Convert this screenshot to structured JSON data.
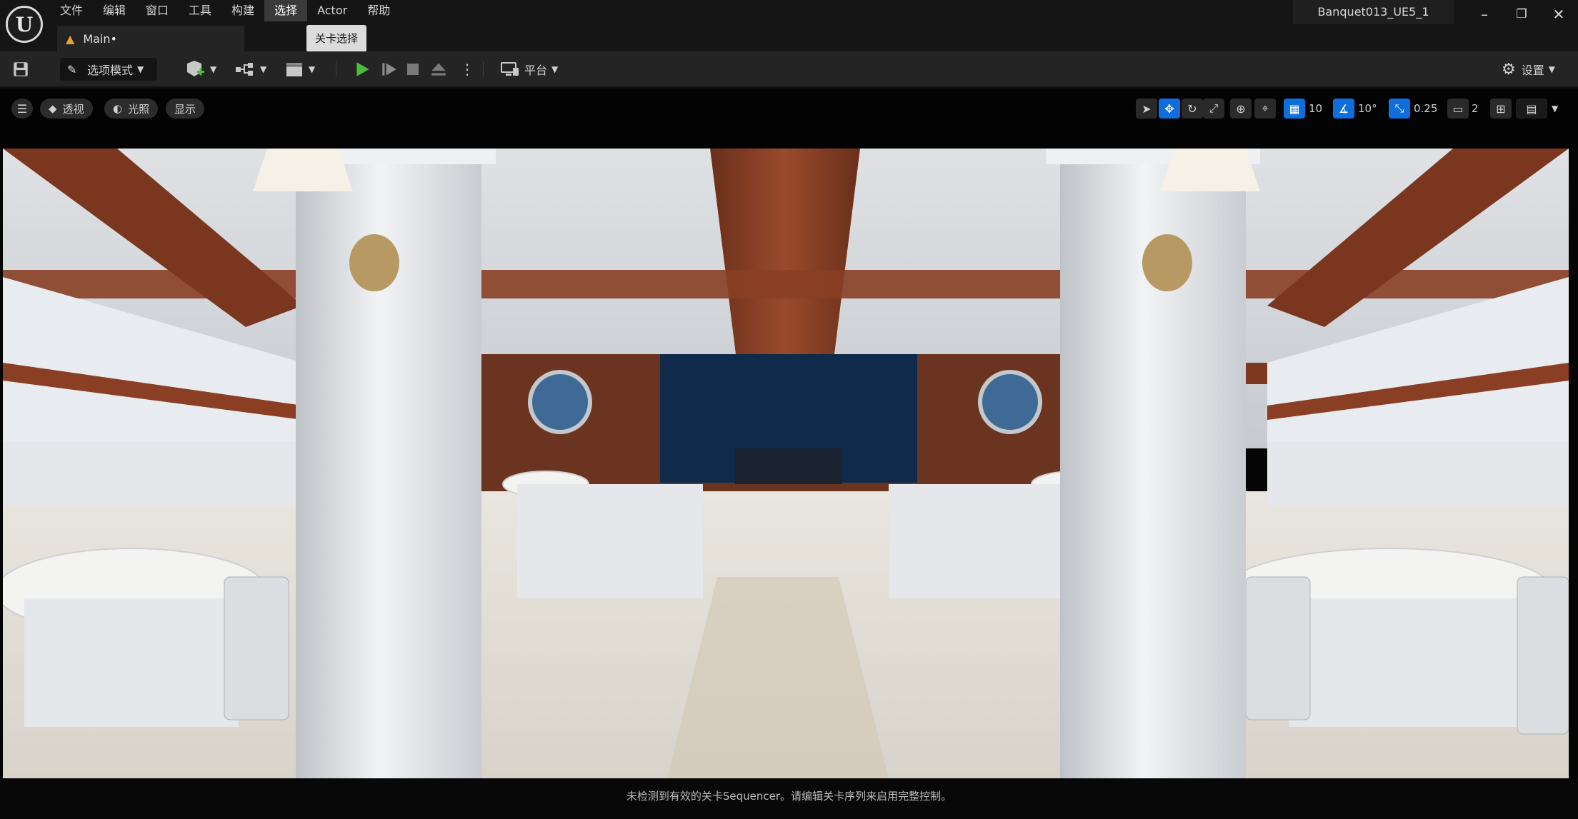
{
  "app": {
    "logo_letter": "U",
    "project_name": "Banquet013_UE5_1"
  },
  "menu": [
    {
      "label": "文件",
      "active": false
    },
    {
      "label": "编辑",
      "active": false
    },
    {
      "label": "窗口",
      "active": false
    },
    {
      "label": "工具",
      "active": false
    },
    {
      "label": "构建",
      "active": false
    },
    {
      "label": "选择",
      "active": true
    },
    {
      "label": "Actor",
      "active": false
    },
    {
      "label": "帮助",
      "active": false
    }
  ],
  "tooltip": "关卡选择",
  "document_tab": {
    "label": "Main•"
  },
  "window_controls": {
    "minimize": "–",
    "restore": "❐",
    "close": "✕"
  },
  "toolbar": {
    "mode_label": "选项模式",
    "platform_label": "平台",
    "settings_label": "设置"
  },
  "viewport_toolbar": {
    "perspective_label": "透视",
    "lighting_label": "光照",
    "show_label": "显示",
    "grid_snap_value": "10",
    "rotation_snap_value": "10°",
    "scale_snap_value": "0.25",
    "camera_speed_value": "2"
  },
  "status_message": "未检测到有效的关卡Sequencer。请编辑关卡序列来启用完整控制。",
  "colors": {
    "play_green": "#4bbd3c",
    "toggle_blue": "#0e6fdc",
    "panel_bg": "#242424",
    "titlebar_bg": "#151515"
  },
  "icons": [
    "unreal-logo-icon",
    "save-icon",
    "mode-icon",
    "add-actor-icon",
    "blueprint-icon",
    "cinematics-icon",
    "play-icon",
    "step-icon",
    "stop-icon",
    "eject-icon",
    "more-icon",
    "platform-icon",
    "gear-icon",
    "hamburger-icon",
    "perspective-cube-icon",
    "lighting-icon",
    "select-icon",
    "translate-icon",
    "rotate-icon",
    "scale-icon",
    "world-icon",
    "surface-snap-icon",
    "grid-snap-icon",
    "rotation-snap-icon",
    "scale-snap-icon",
    "camera-icon",
    "layout-icon"
  ]
}
